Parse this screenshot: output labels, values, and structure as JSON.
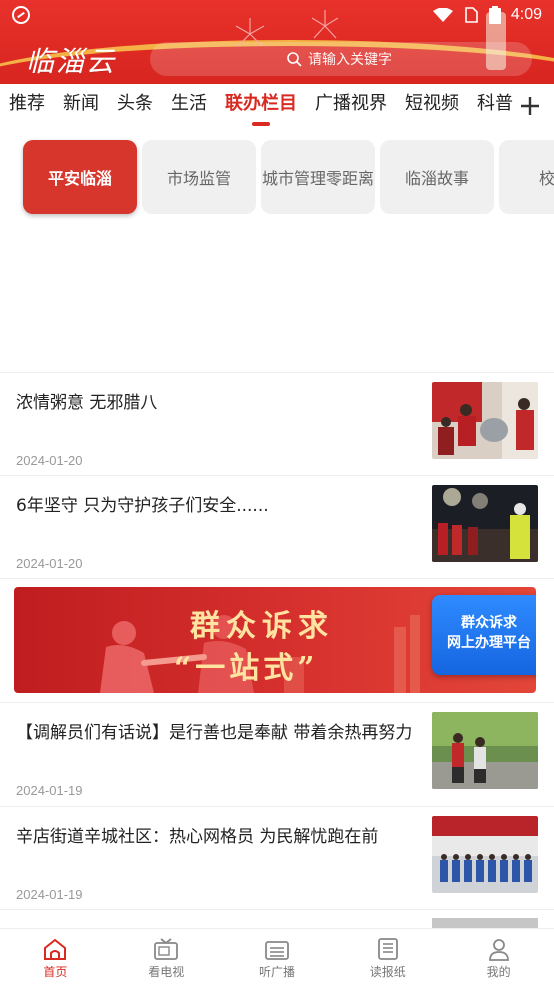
{
  "status_bar": {
    "time": "4:09"
  },
  "header": {
    "logo_text": "临淄云",
    "search_placeholder": "请输入关键字"
  },
  "nav_tabs": [
    {
      "label": "推荐"
    },
    {
      "label": "新闻"
    },
    {
      "label": "头条"
    },
    {
      "label": "生活"
    },
    {
      "label": "联办栏目",
      "active": true
    },
    {
      "label": "广播视界"
    },
    {
      "label": "短视频"
    },
    {
      "label": "科普E"
    }
  ],
  "subcategories": [
    {
      "label": "平安临淄",
      "active": true
    },
    {
      "label": "市场监管"
    },
    {
      "label": "城市管理零距离"
    },
    {
      "label": "临淄故事"
    },
    {
      "label": "校"
    }
  ],
  "news": [
    {
      "title": "浓情粥意  无邪腊八",
      "date": "2024-01-20"
    },
    {
      "title": "6年坚守  只为守护孩子们安全......",
      "date": "2024-01-20"
    },
    {
      "title": "【调解员们有话说】是行善也是奉献  带着余热再努力",
      "date": "2024-01-19"
    },
    {
      "title": "辛店街道辛城社区：热心网格员  为民解忧跑在前",
      "date": "2024-01-19"
    }
  ],
  "banner": {
    "title_line1": "群众诉求",
    "title_line2": "“一站式”",
    "card_line1": "群众诉求",
    "card_line2": "网上办理平台"
  },
  "bottom_nav": [
    {
      "label": "首页",
      "icon": "home-icon",
      "active": true
    },
    {
      "label": "看电视",
      "icon": "tv-icon"
    },
    {
      "label": "听广播",
      "icon": "radio-icon"
    },
    {
      "label": "读报纸",
      "icon": "newspaper-icon"
    },
    {
      "label": "我的",
      "icon": "user-icon"
    }
  ],
  "colors": {
    "brand_red": "#d92a22",
    "header_red": "#e8312b",
    "accent_gold": "#f7c04a"
  }
}
